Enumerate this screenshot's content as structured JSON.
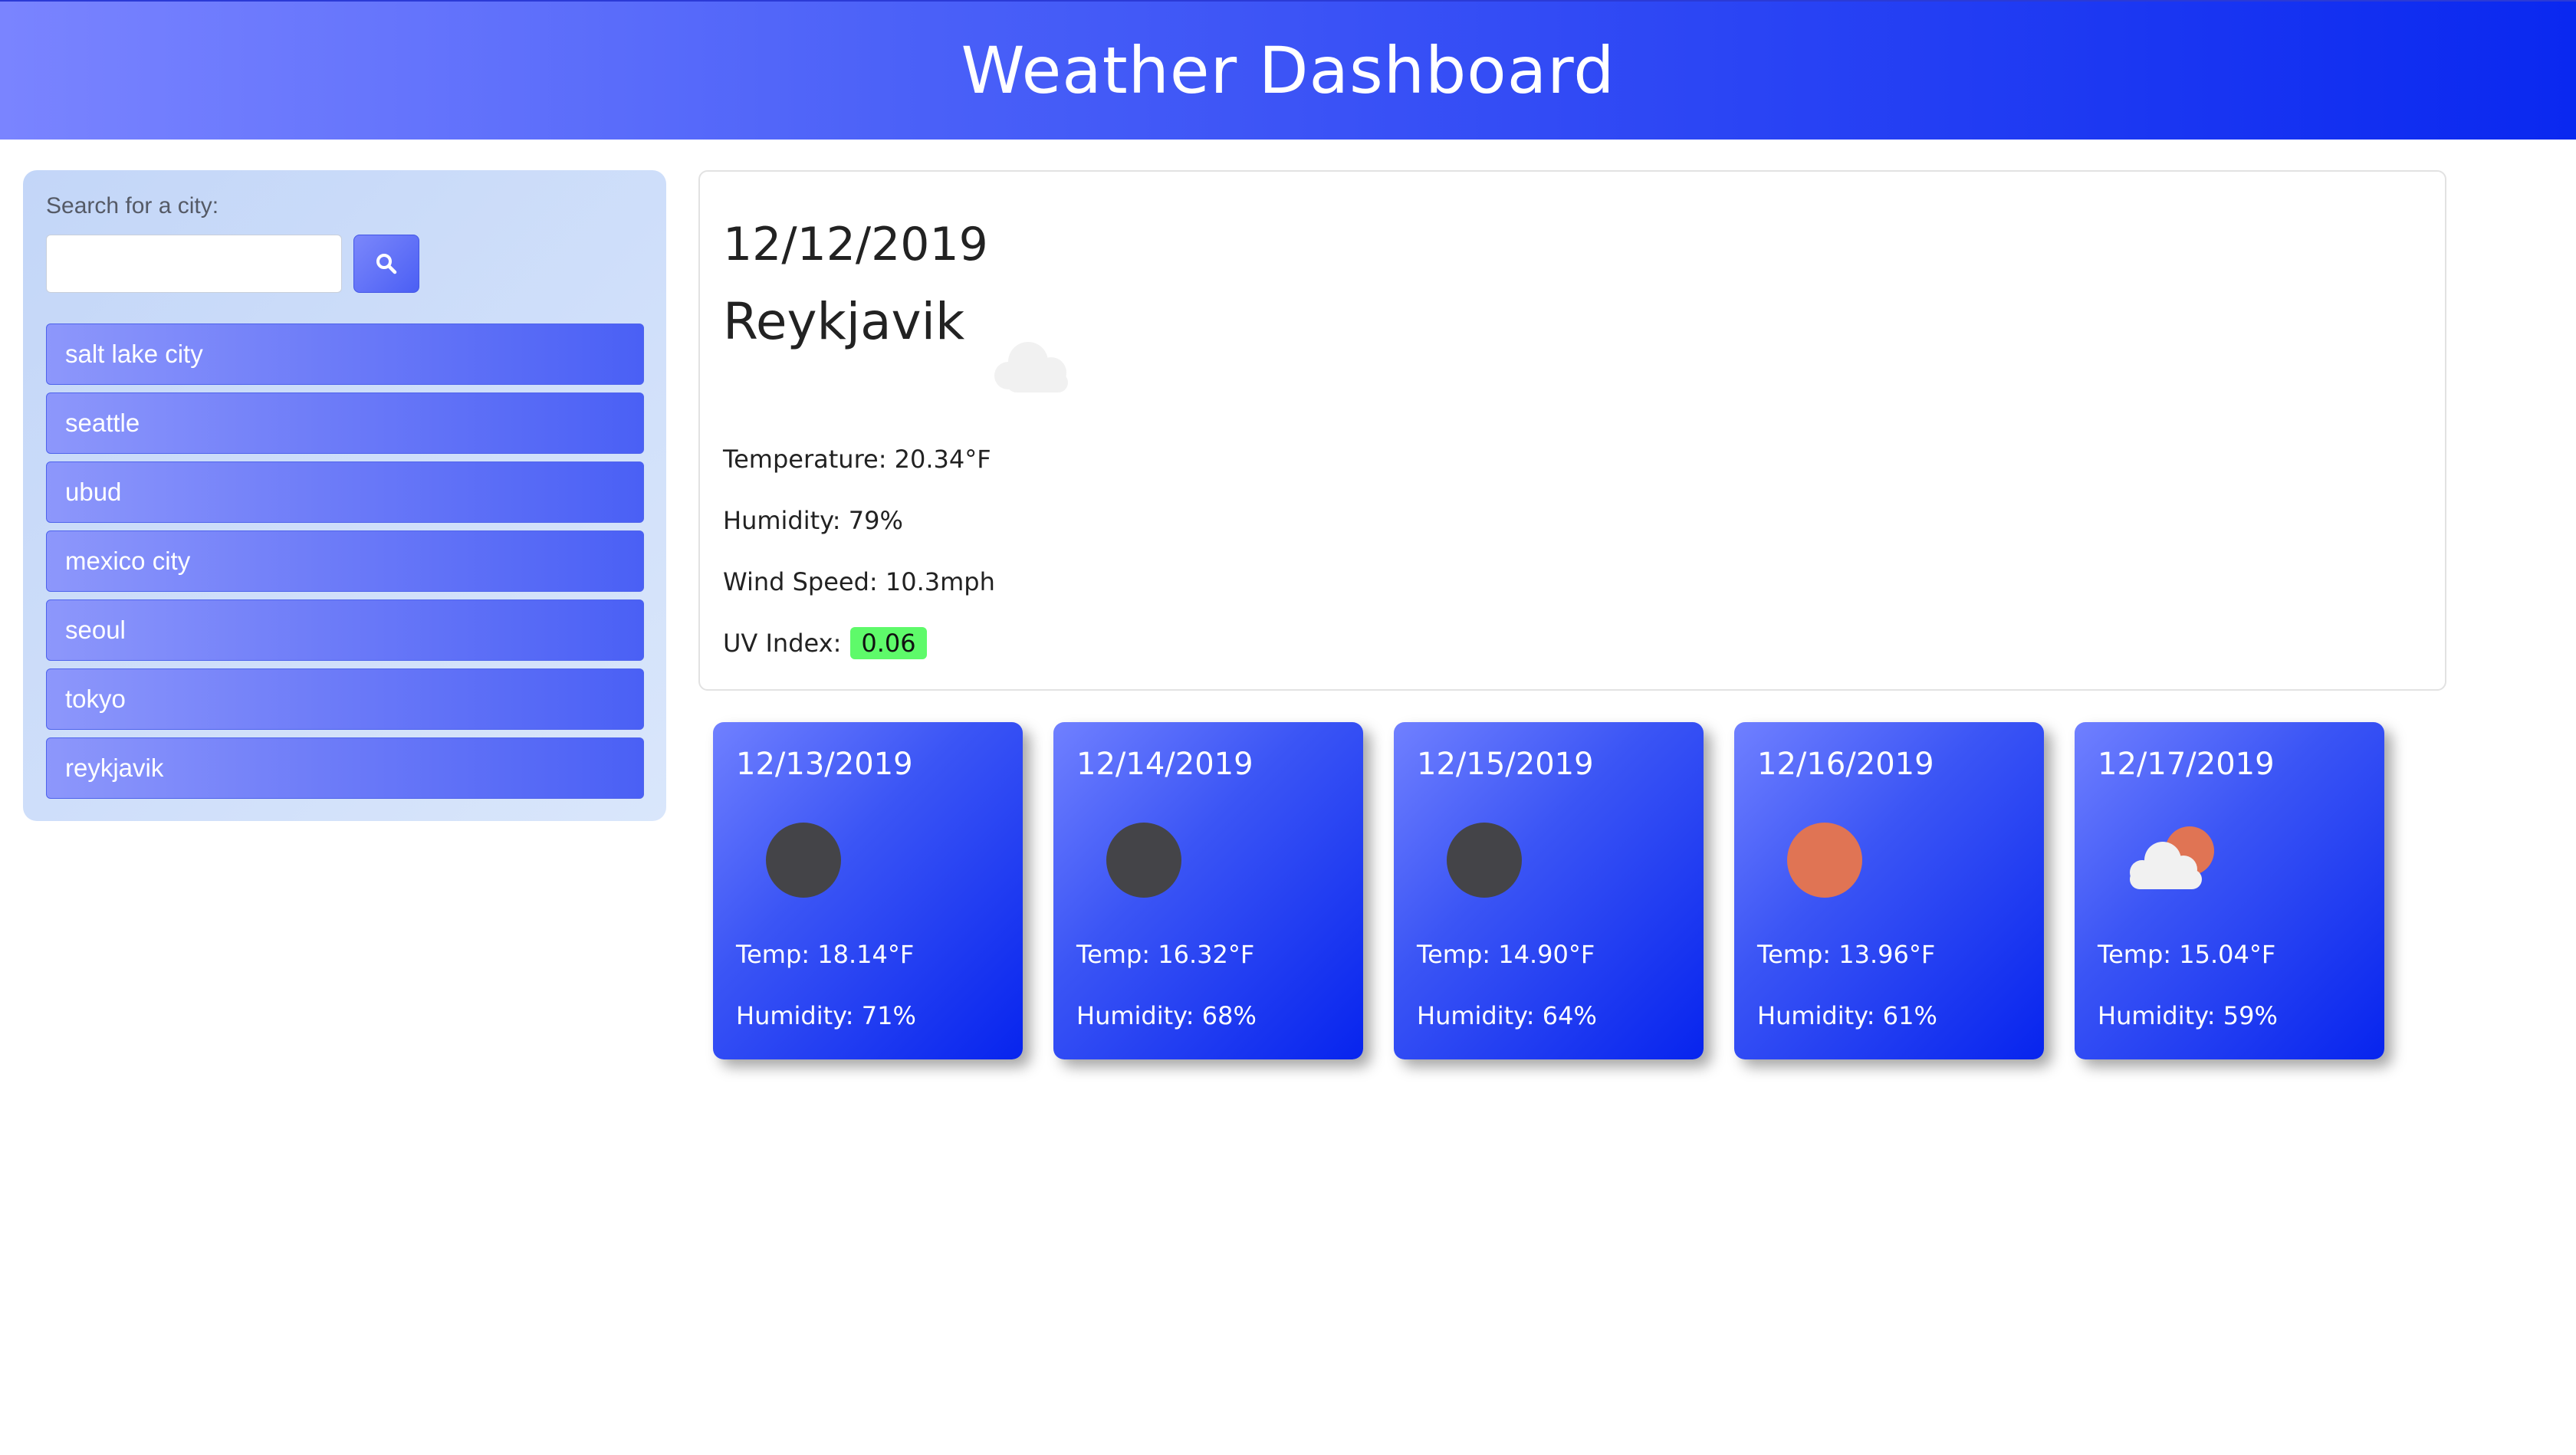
{
  "header": {
    "title": "Weather Dashboard"
  },
  "search": {
    "label": "Search for a city:",
    "value": "",
    "placeholder": "",
    "button_icon": "search-icon"
  },
  "cities": [
    {
      "label": "salt lake city"
    },
    {
      "label": "seattle"
    },
    {
      "label": "ubud"
    },
    {
      "label": "mexico city"
    },
    {
      "label": "seoul"
    },
    {
      "label": "tokyo"
    },
    {
      "label": "reykjavik"
    }
  ],
  "current": {
    "date": "12/12/2019",
    "city": "Reykjavik",
    "icon": "cloud-icon",
    "temperature": "Temperature: 20.34°F",
    "humidity": "Humidity: 79%",
    "wind": "Wind Speed: 10.3mph",
    "uv_label": "UV Index:",
    "uv_value": "0.06",
    "uv_color": "#5efa6a"
  },
  "forecast": [
    {
      "date": "12/13/2019",
      "icon": "moon-icon",
      "temp": "Temp: 18.14°F",
      "humidity": "Humidity: 71%"
    },
    {
      "date": "12/14/2019",
      "icon": "moon-icon",
      "temp": "Temp: 16.32°F",
      "humidity": "Humidity: 68%"
    },
    {
      "date": "12/15/2019",
      "icon": "moon-icon",
      "temp": "Temp: 14.90°F",
      "humidity": "Humidity: 64%"
    },
    {
      "date": "12/16/2019",
      "icon": "sun-icon",
      "temp": "Temp: 13.96°F",
      "humidity": "Humidity: 61%"
    },
    {
      "date": "12/17/2019",
      "icon": "partly-cloudy-icon",
      "temp": "Temp: 15.04°F",
      "humidity": "Humidity: 59%"
    }
  ],
  "colors": {
    "header_start": "#7a84ff",
    "header_end": "#0a28f0",
    "sidebar_bg": "#c3d6f8",
    "moon": "#444448",
    "sun": "#e07454",
    "cloud": "#f1f1f1"
  }
}
